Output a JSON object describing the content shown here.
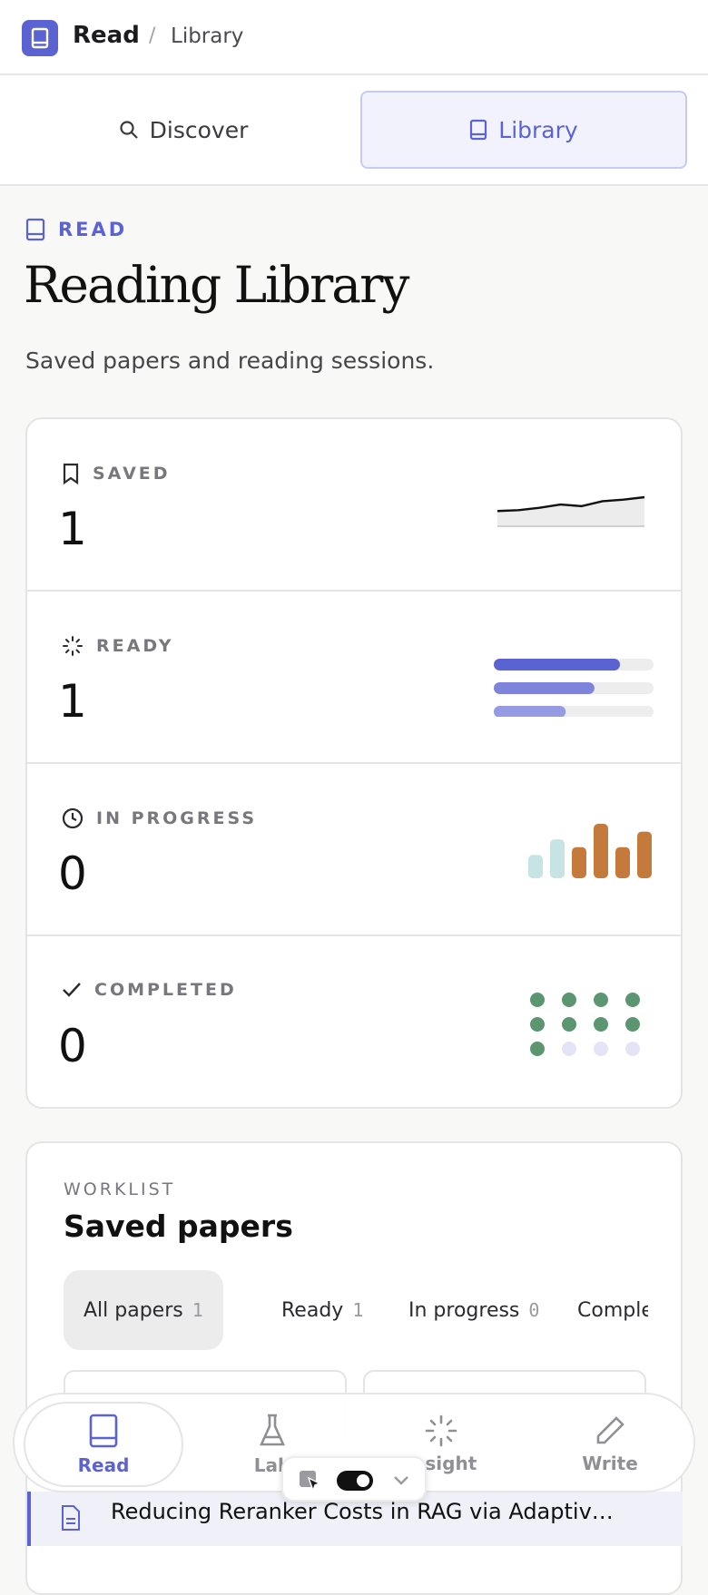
{
  "topbar": {
    "crumb_root": "Read",
    "crumb_sep": "/",
    "crumb_current": "Library",
    "logo_icon": "book-icon"
  },
  "tabs": [
    {
      "label": "Discover",
      "icon": "search-icon",
      "active": false
    },
    {
      "label": "Library",
      "icon": "book-icon",
      "active": true
    }
  ],
  "header": {
    "eyebrow": "READ",
    "title": "Reading Library",
    "subtitle": "Saved papers and reading sessions."
  },
  "stats": [
    {
      "label": "SAVED",
      "value": "1",
      "icon": "bookmark-icon",
      "viz": "sparkline",
      "spark": [
        12,
        13,
        16,
        20,
        18,
        24,
        26,
        29
      ]
    },
    {
      "label": "READY",
      "value": "1",
      "icon": "loader-icon",
      "viz": "progress-bars",
      "bars": [
        0.79,
        0.63,
        0.45
      ]
    },
    {
      "label": "IN PROGRESS",
      "value": "0",
      "icon": "clock-icon",
      "viz": "mini-bars",
      "bars": [
        3,
        5,
        4,
        7,
        4,
        6
      ]
    },
    {
      "label": "COMPLETED",
      "value": "0",
      "icon": "check-icon",
      "viz": "dot-grid",
      "filled": 9,
      "total": 12
    }
  ],
  "colors": {
    "accent": "#5b63d3",
    "spark_fill": "#ececec",
    "teal_light": "#c6e4e4",
    "orange": "#c47a3a",
    "green": "#5b9670",
    "dot_empty": "#e3e4f5"
  },
  "worklist": {
    "eyebrow": "WORKLIST",
    "title": "Saved papers",
    "filters": [
      {
        "label": "All papers",
        "count": "1",
        "active": true
      },
      {
        "label": "Ready",
        "count": "1",
        "active": false
      },
      {
        "label": "In progress",
        "count": "0",
        "active": false
      },
      {
        "label": "Completed",
        "count": "",
        "active": false
      }
    ]
  },
  "paper": {
    "title": "Reducing Reranker Costs in RAG via Adaptiv…"
  },
  "bottom_nav": [
    {
      "label": "Read",
      "icon": "book-icon",
      "active": true
    },
    {
      "label": "Lab",
      "icon": "flask-icon",
      "active": false
    },
    {
      "label": "Insight",
      "icon": "loader-icon",
      "active": false
    },
    {
      "label": "Write",
      "icon": "pencil-icon",
      "active": false
    }
  ]
}
